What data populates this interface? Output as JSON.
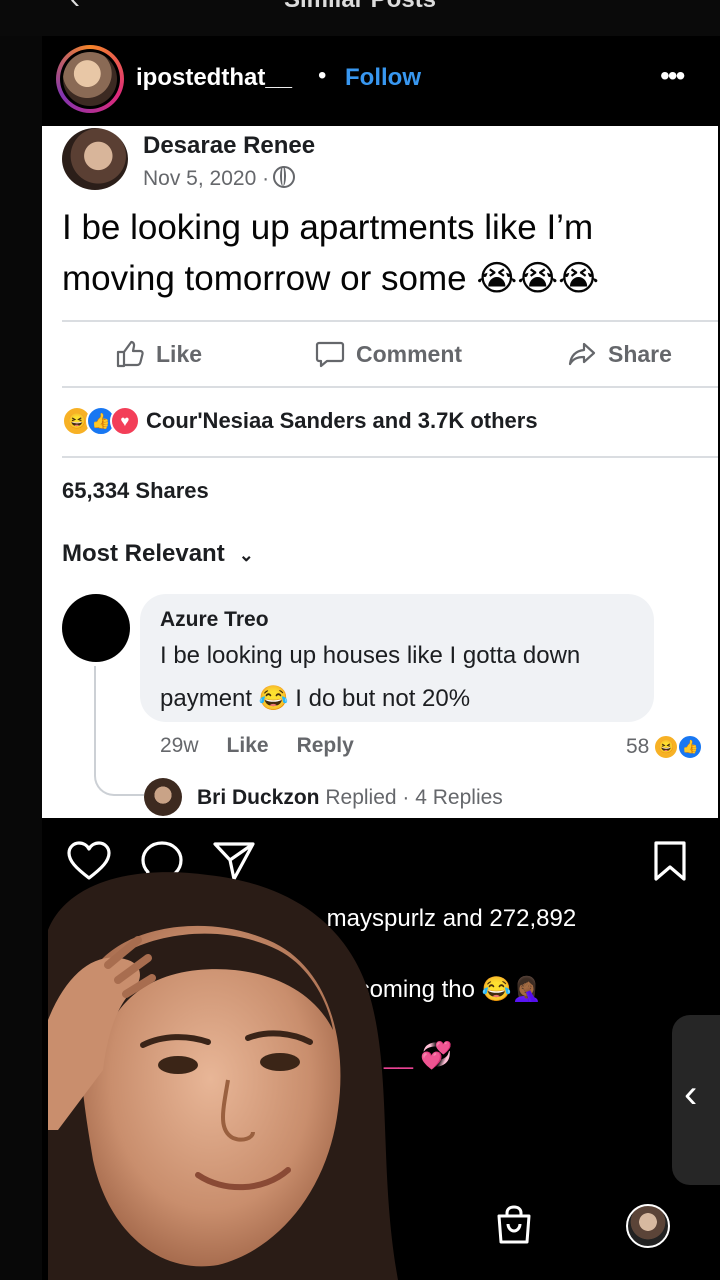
{
  "top": {
    "title": "Similar Posts"
  },
  "post": {
    "username": "ipostedthat__",
    "separator": "•",
    "follow_label": "Follow",
    "more_label": "•••"
  },
  "fb": {
    "author": "Desarae Renee",
    "date": "Nov 5, 2020 ·",
    "text": "I be looking up apartments like I’m moving tomorrow or some",
    "emojis": "😭😭😭",
    "actions": {
      "like": "Like",
      "comment": "Comment",
      "share": "Share"
    },
    "reactions_text": "Cour'Nesiaa Sanders and 3.7K others",
    "shares": "65,334 Shares",
    "sort_label": "Most Relevant",
    "comment": {
      "name": "Azure Treo",
      "text": "I be looking up houses like I gotta down payment 😂 I do but not 20%",
      "time": "29w",
      "like": "Like",
      "reply": "Reply",
      "count": "58"
    },
    "reply_summary": {
      "name": "Bri Duckzon",
      "text": "Replied · 4 Replies"
    }
  },
  "ig": {
    "liked_by_text": "e, mayspurlz and 272,892",
    "caption_text": "it’s coming tho 😂🤦🏾‍♀️",
    "comment_fragment": "__ 💞"
  }
}
